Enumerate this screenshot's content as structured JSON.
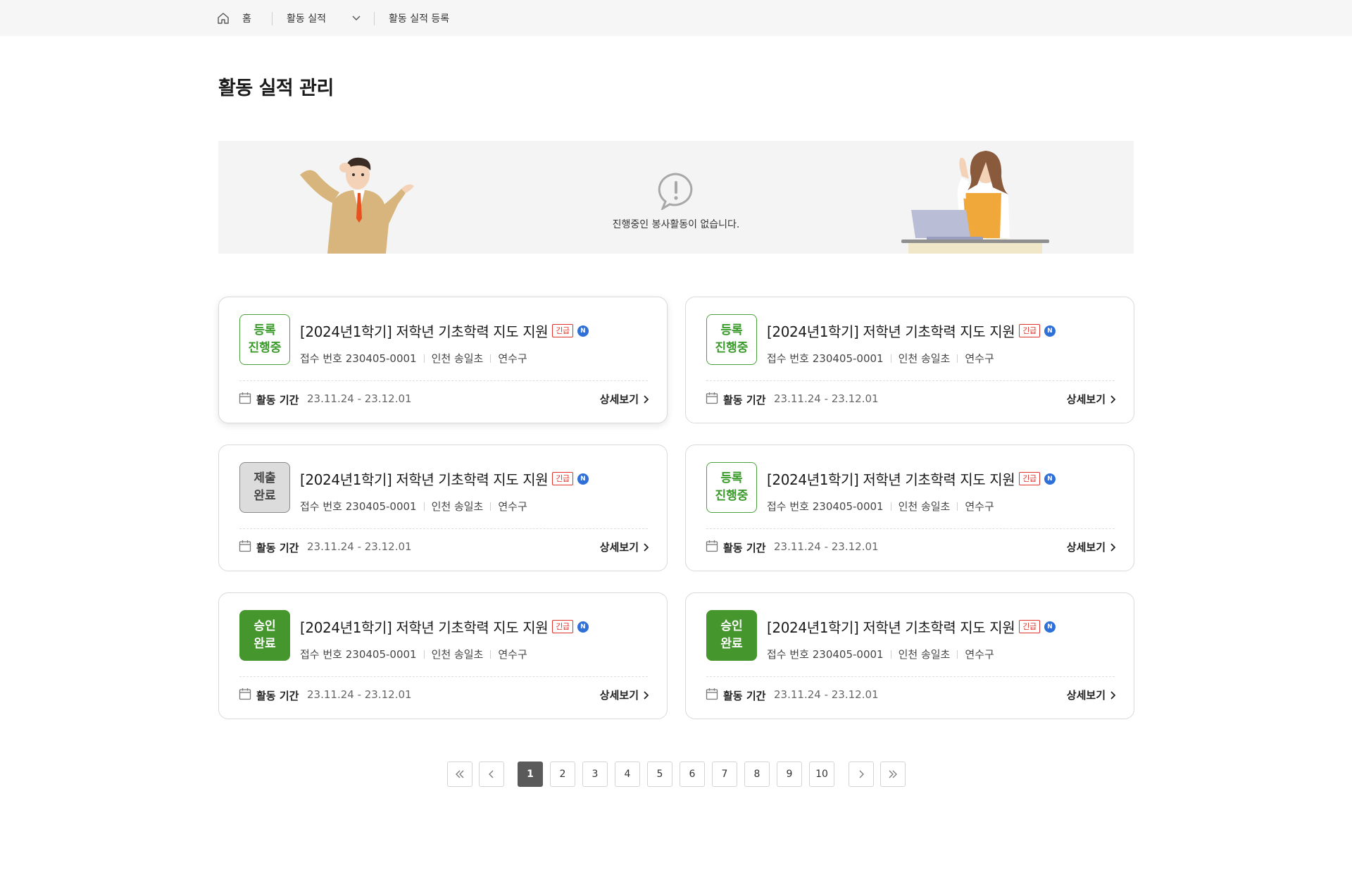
{
  "breadcrumb": {
    "home_label": "홈",
    "section_label": "활동 실적",
    "current_label": "활동 실적 등록"
  },
  "page_title": "활동 실적 관리",
  "empty_banner": {
    "message": "진행중인 봉사활동이 없습니다."
  },
  "cards": [
    {
      "status_line1": "등록",
      "status_line2": "진행중",
      "status_type": "progress",
      "title": "[2024년1학기] 저학년 기초학력 지도 지원",
      "urgent_tag": "긴급",
      "new_tag": "N",
      "receipt": "접수 번호 230405-0001",
      "city": "인천 송일초",
      "district": "연수구",
      "period_label": "활동 기간",
      "period_value": "23.11.24 - 23.12.01",
      "detail_label": "상세보기"
    },
    {
      "status_line1": "등록",
      "status_line2": "진행중",
      "status_type": "progress",
      "title": "[2024년1학기] 저학년 기초학력 지도 지원",
      "urgent_tag": "긴급",
      "new_tag": "N",
      "receipt": "접수 번호 230405-0001",
      "city": "인천 송일초",
      "district": "연수구",
      "period_label": "활동 기간",
      "period_value": "23.11.24 - 23.12.01",
      "detail_label": "상세보기"
    },
    {
      "status_line1": "제출",
      "status_line2": "완료",
      "status_type": "submitted",
      "title": "[2024년1학기] 저학년 기초학력 지도 지원",
      "urgent_tag": "긴급",
      "new_tag": "N",
      "receipt": "접수 번호 230405-0001",
      "city": "인천 송일초",
      "district": "연수구",
      "period_label": "활동 기간",
      "period_value": "23.11.24 - 23.12.01",
      "detail_label": "상세보기"
    },
    {
      "status_line1": "등록",
      "status_line2": "진행중",
      "status_type": "progress",
      "title": "[2024년1학기] 저학년 기초학력 지도 지원",
      "urgent_tag": "긴급",
      "new_tag": "N",
      "receipt": "접수 번호 230405-0001",
      "city": "인천 송일초",
      "district": "연수구",
      "period_label": "활동 기간",
      "period_value": "23.11.24 - 23.12.01",
      "detail_label": "상세보기"
    },
    {
      "status_line1": "승인",
      "status_line2": "완료",
      "status_type": "approved",
      "title": "[2024년1학기] 저학년 기초학력 지도 지원",
      "urgent_tag": "긴급",
      "new_tag": "N",
      "receipt": "접수 번호 230405-0001",
      "city": "인천 송일초",
      "district": "연수구",
      "period_label": "활동 기간",
      "period_value": "23.11.24 - 23.12.01",
      "detail_label": "상세보기"
    },
    {
      "status_line1": "승인",
      "status_line2": "완료",
      "status_type": "approved",
      "title": "[2024년1학기] 저학년 기초학력 지도 지원",
      "urgent_tag": "긴급",
      "new_tag": "N",
      "receipt": "접수 번호 230405-0001",
      "city": "인천 송일초",
      "district": "연수구",
      "period_label": "활동 기간",
      "period_value": "23.11.24 - 23.12.01",
      "detail_label": "상세보기"
    }
  ],
  "pagination": {
    "pages": [
      "1",
      "2",
      "3",
      "4",
      "5",
      "6",
      "7",
      "8",
      "9",
      "10"
    ],
    "current": "1"
  },
  "colors": {
    "progress": "#3a9a2a",
    "approved": "#44962d",
    "urgent": "#e0342a",
    "new": "#2f6fd8",
    "active_page": "#5a5a5a"
  }
}
